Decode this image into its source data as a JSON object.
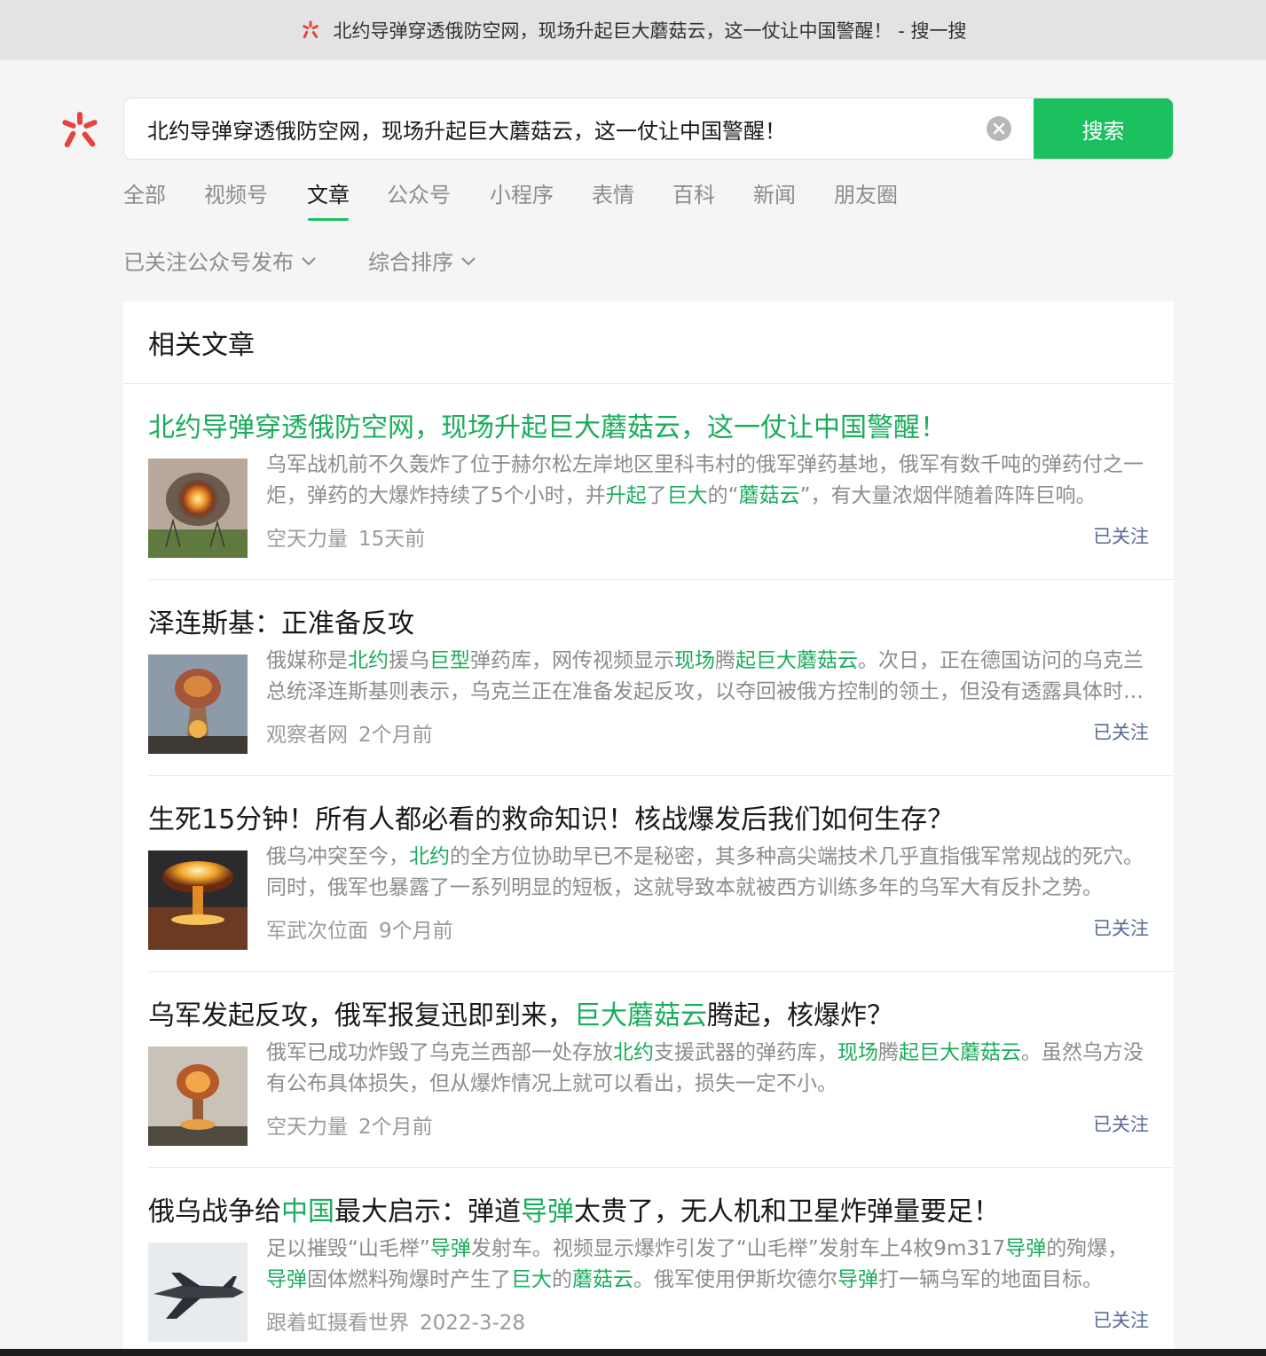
{
  "window": {
    "title": "北约导弹穿透俄防空网，现场升起巨大蘑菇云，这一仗让中国警醒！ - 搜一搜"
  },
  "search": {
    "value": "北约导弹穿透俄防空网，现场升起巨大蘑菇云，这一仗让中国警醒！",
    "button_label": "搜索"
  },
  "tabs": [
    {
      "label": "全部"
    },
    {
      "label": "视频号"
    },
    {
      "label": "文章",
      "active": true
    },
    {
      "label": "公众号"
    },
    {
      "label": "小程序"
    },
    {
      "label": "表情"
    },
    {
      "label": "百科"
    },
    {
      "label": "新闻"
    },
    {
      "label": "朋友圈"
    }
  ],
  "filters": [
    {
      "label": "已关注公众号发布"
    },
    {
      "label": "综合排序"
    }
  ],
  "section": {
    "title": "相关文章"
  },
  "results": [
    {
      "title_link": true,
      "title": [
        {
          "t": "北约导弹穿透俄防空网，现场升起巨大蘑菇云，这一仗让中国警醒！"
        }
      ],
      "snippet": [
        {
          "t": "乌军战机前不久轰炸了位于赫尔松左岸地区里科韦村的俄军弹药基地，俄军有数千吨的弹药付之一炬，弹药的大爆炸持续了5个小时，并"
        },
        {
          "t": "升起",
          "hl": true
        },
        {
          "t": "了"
        },
        {
          "t": "巨大",
          "hl": true
        },
        {
          "t": "的“"
        },
        {
          "t": "蘑菇云",
          "hl": true
        },
        {
          "t": "”，有大量浓烟伴随着阵阵巨响。"
        }
      ],
      "source": "空天力量",
      "time": "15天前",
      "follow": "已关注",
      "thumb": "fireball"
    },
    {
      "title": [
        {
          "t": "泽连斯基：正准备反攻"
        }
      ],
      "snippet": [
        {
          "t": "俄媒称是"
        },
        {
          "t": "北约",
          "hl": true
        },
        {
          "t": "援乌"
        },
        {
          "t": "巨型",
          "hl": true
        },
        {
          "t": "弹药库，网传视频显示"
        },
        {
          "t": "现场",
          "hl": true
        },
        {
          "t": "腾"
        },
        {
          "t": "起巨大蘑菇云",
          "hl": true
        },
        {
          "t": "。次日，正在德国访问的乌克兰总统泽连斯基则表示，乌克兰正在准备发起反攻，以夺回被俄方控制的领土，但没有透露具体时间。"
        }
      ],
      "source": "观察者网",
      "time": "2个月前",
      "follow": "已关注",
      "thumb": "mushroom"
    },
    {
      "title": [
        {
          "t": "生死15分钟！所有人都必看的救命知识！核战爆发后我们如何生存？"
        }
      ],
      "snippet": [
        {
          "t": "俄乌冲突至今，"
        },
        {
          "t": "北约",
          "hl": true
        },
        {
          "t": "的全方位协助早已不是秘密，其多种高尖端技术几乎直指俄军常规战的死穴。同时，俄军也暴露了一系列明显的短板，这就导致本就被西方训练多年的乌军大有反扑之势。"
        }
      ],
      "source": "军武次位面",
      "time": "9个月前",
      "follow": "已关注",
      "thumb": "nuke"
    },
    {
      "title": [
        {
          "t": "乌军发起反攻，俄军报复迅即到来，"
        },
        {
          "t": "巨大蘑菇云",
          "hl": true
        },
        {
          "t": "腾起，核爆炸？"
        }
      ],
      "snippet": [
        {
          "t": "俄军已成功炸毁了乌克兰西部一处存放"
        },
        {
          "t": "北约",
          "hl": true
        },
        {
          "t": "支援武器的弹药库，"
        },
        {
          "t": "现场",
          "hl": true
        },
        {
          "t": "腾"
        },
        {
          "t": "起巨大蘑菇云",
          "hl": true
        },
        {
          "t": "。虽然乌方没有公布具体损失，但从爆炸情况上就可以看出，损失一定不小。"
        }
      ],
      "source": "空天力量",
      "time": "2个月前",
      "follow": "已关注",
      "thumb": "mushroom2"
    },
    {
      "title": [
        {
          "t": "俄乌战争给"
        },
        {
          "t": "中国",
          "hl": true
        },
        {
          "t": "最大启示：弹道"
        },
        {
          "t": "导弹",
          "hl": true
        },
        {
          "t": "太贵了，无人机和卫星炸弹量要足！"
        }
      ],
      "snippet": [
        {
          "t": "足以摧毁“山毛榉”"
        },
        {
          "t": "导弹",
          "hl": true
        },
        {
          "t": "发射车。视频显示爆炸引发了“山毛榉”发射车上4枚9m317"
        },
        {
          "t": "导弹",
          "hl": true
        },
        {
          "t": "的殉爆，"
        },
        {
          "t": "导弹",
          "hl": true
        },
        {
          "t": "固体燃料殉爆时产生了"
        },
        {
          "t": "巨大",
          "hl": true
        },
        {
          "t": "的"
        },
        {
          "t": "蘑菇云",
          "hl": true
        },
        {
          "t": "。俄军使用伊斯坎德尔"
        },
        {
          "t": "导弹",
          "hl": true
        },
        {
          "t": "打一辆乌军的地面目标。"
        }
      ],
      "source": "跟着虹摄看世界",
      "time": "2022-3-28",
      "follow": "已关注",
      "thumb": "jet"
    }
  ],
  "colors": {
    "accent": "#1bc05f",
    "highlight": "#1aad5c",
    "follow": "#576b95",
    "logo": "#e64340"
  }
}
